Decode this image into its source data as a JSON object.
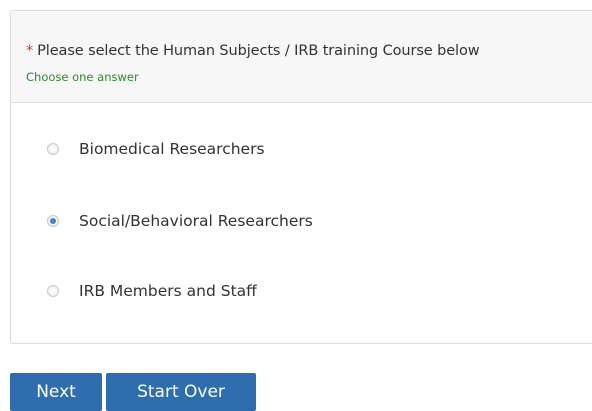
{
  "question": {
    "required_marker": "*",
    "text": "Please select the Human Subjects / IRB training Course below",
    "hint": "Choose one answer"
  },
  "options": [
    {
      "label": "Biomedical Researchers",
      "selected": false
    },
    {
      "label": "Social/Behavioral Researchers",
      "selected": true
    },
    {
      "label": "IRB Members and Staff",
      "selected": false
    }
  ],
  "buttons": {
    "next_label": "Next",
    "start_over_label": "Start Over"
  },
  "colors": {
    "button_bg": "#2f6eae",
    "hint": "#2e8b2e",
    "required": "#d9352c",
    "radio_selected": "#4a7fc1"
  }
}
